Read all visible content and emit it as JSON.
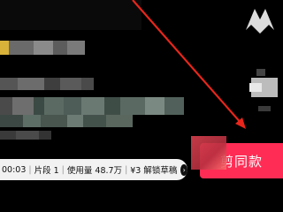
{
  "colors": {
    "background": "#000000",
    "annotation_arrow": "#e8261b",
    "cta_bg": "#ff2d55",
    "info_bar_bg": "#f2f2f2"
  },
  "info_bar": {
    "duration": "00:03",
    "clips": "片段 1",
    "usage": "使用量 48.7万",
    "price_label": "¥3 解锁草稿",
    "arrow_icon": "chevron-right-icon"
  },
  "cta": {
    "label": "剪同款"
  }
}
